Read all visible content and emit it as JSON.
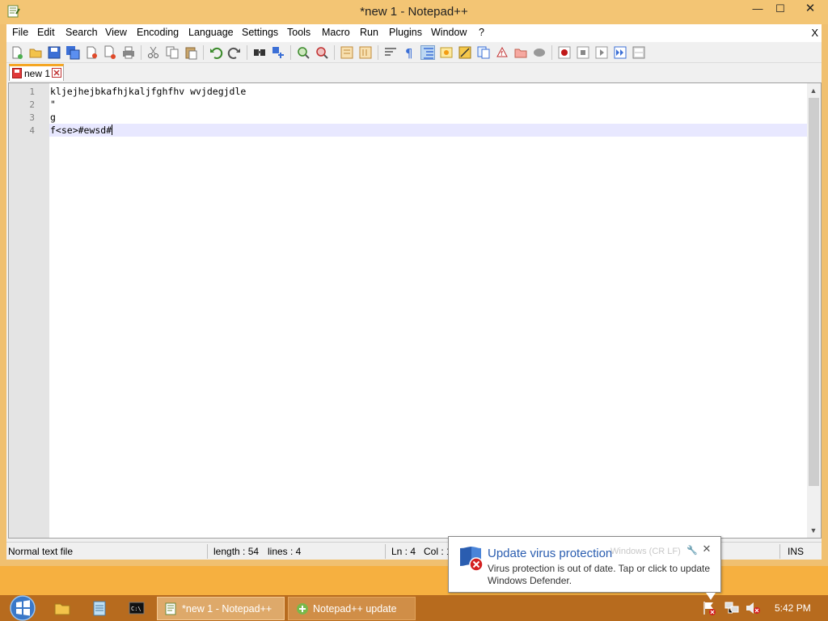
{
  "window": {
    "title": "*new 1 - Notepad++",
    "min_glyph": "—",
    "max_glyph": "☐",
    "close_glyph": "✕"
  },
  "menu": {
    "items": [
      "File",
      "Edit",
      "Search",
      "View",
      "Encoding",
      "Language",
      "Settings",
      "Tools",
      "Macro",
      "Run",
      "Plugins",
      "Window",
      "?"
    ],
    "close_glyph": "X"
  },
  "toolbar": {
    "icons": [
      "new-file-icon",
      "open-file-icon",
      "save-icon",
      "save-all-icon",
      "close-icon",
      "close-all-icon",
      "print-icon",
      "cut-icon",
      "copy-icon",
      "paste-icon",
      "undo-icon",
      "redo-icon",
      "find-icon",
      "replace-icon",
      "zoom-in-icon",
      "zoom-out-icon",
      "sync-vertical-icon",
      "sync-horizontal-icon",
      "word-wrap-icon",
      "show-all-chars-icon",
      "indent-guide-icon",
      "user-language-icon",
      "doc-map-icon",
      "function-list-icon",
      "folder-workspace-icon",
      "monitor-icon",
      "macro-record-icon",
      "macro-stop-icon",
      "macro-play-icon",
      "macro-run-multiple-icon",
      "macro-save-icon"
    ]
  },
  "tabs": [
    {
      "label": "new 1"
    }
  ],
  "editor": {
    "lines": [
      {
        "num": "1",
        "text": "kljejhejbkafhjkaljfghfhv wvjdegjdle"
      },
      {
        "num": "2",
        "text": "\""
      },
      {
        "num": "3",
        "text": "g"
      },
      {
        "num": "4",
        "text": "f<se>#ewsd#"
      }
    ],
    "current_line": 4
  },
  "status": {
    "file_type": "Normal text file",
    "length": "length : 54",
    "lines": "lines : 4",
    "ln": "Ln : 4",
    "col": "Col : 1",
    "eol": "Windows (CR LF)",
    "ins": "INS"
  },
  "balloon": {
    "title": "Update virus protection",
    "body": "Virus protection is out of date. Tap or click to update Windows Defender.",
    "close_glyph": "✕",
    "tool_glyph": "🔧"
  },
  "taskbar": {
    "tasks": [
      {
        "label": "*new 1 - Notepad++",
        "active": true
      },
      {
        "label": "Notepad++ update",
        "active": false
      }
    ],
    "clock": "5:42 PM"
  },
  "colors": {
    "desktop": "#f6b040",
    "taskbar": "#b76b1e",
    "titlebar": "#f3c574",
    "current_line": "#e8e8ff",
    "balloon_title": "#2a5db0"
  }
}
